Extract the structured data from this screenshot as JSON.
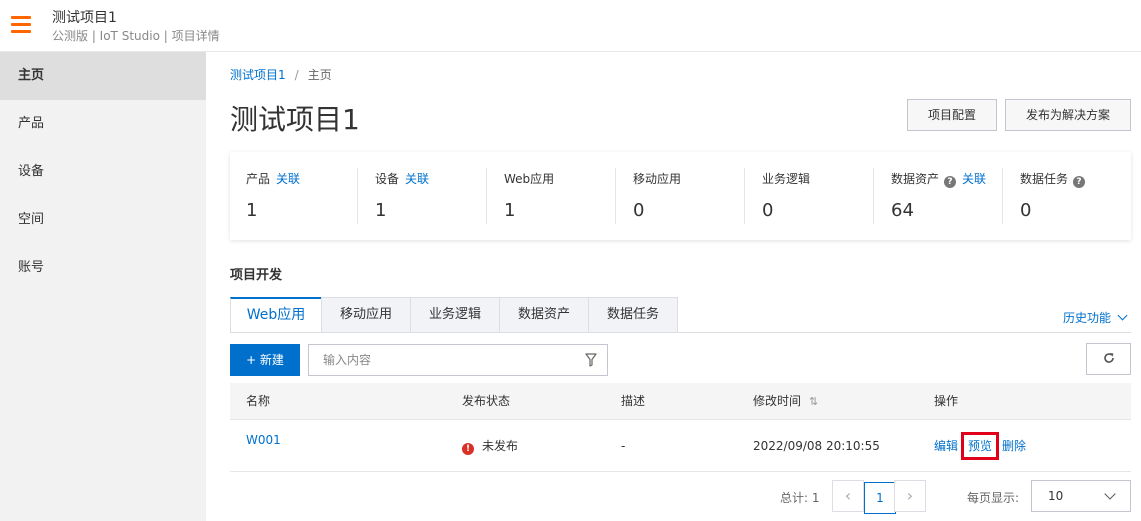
{
  "header": {
    "title": "测试项目1",
    "subtitle": "公测版 | IoT Studio | 项目详情"
  },
  "sidebar": {
    "items": [
      {
        "label": "主页",
        "active": true
      },
      {
        "label": "产品"
      },
      {
        "label": "设备"
      },
      {
        "label": "空间"
      },
      {
        "label": "账号"
      }
    ]
  },
  "breadcrumb": {
    "parent": "测试项目1",
    "separator": "/",
    "current": "主页"
  },
  "page": {
    "title": "测试项目1",
    "config_button": "项目配置",
    "publish_button": "发布为解决方案"
  },
  "stats": [
    {
      "label": "产品",
      "link": "关联",
      "value": "1"
    },
    {
      "label": "设备",
      "link": "关联",
      "value": "1"
    },
    {
      "label": "Web应用",
      "value": "1"
    },
    {
      "label": "移动应用",
      "value": "0"
    },
    {
      "label": "业务逻辑",
      "value": "0"
    },
    {
      "label": "数据资产",
      "help": "?",
      "link": "关联",
      "value": "64"
    },
    {
      "label": "数据任务",
      "help": "?",
      "value": "0"
    }
  ],
  "dev": {
    "section_title": "项目开发",
    "tabs": [
      "Web应用",
      "移动应用",
      "业务逻辑",
      "数据资产",
      "数据任务"
    ],
    "active_tab": "Web应用",
    "history_label": "历史功能",
    "new_button": "+ 新建",
    "search_placeholder": "输入内容"
  },
  "table": {
    "columns": [
      "名称",
      "发布状态",
      "描述",
      "修改时间",
      "操作"
    ],
    "rows": [
      {
        "name": "W001",
        "status": "未发布",
        "status_icon": "!",
        "description": "-",
        "modified": "2022/09/08 20:10:55",
        "actions": [
          "编辑",
          "预览",
          "删除"
        ]
      }
    ]
  },
  "pagination": {
    "total_label": "总计: 1",
    "current_page": "1",
    "per_page_label": "每页显示:",
    "per_page_value": "10"
  },
  "colors": {
    "accent": "#0070cc",
    "menu": "#ff6600",
    "highlight": "#e0001a",
    "error": "#d93026"
  }
}
